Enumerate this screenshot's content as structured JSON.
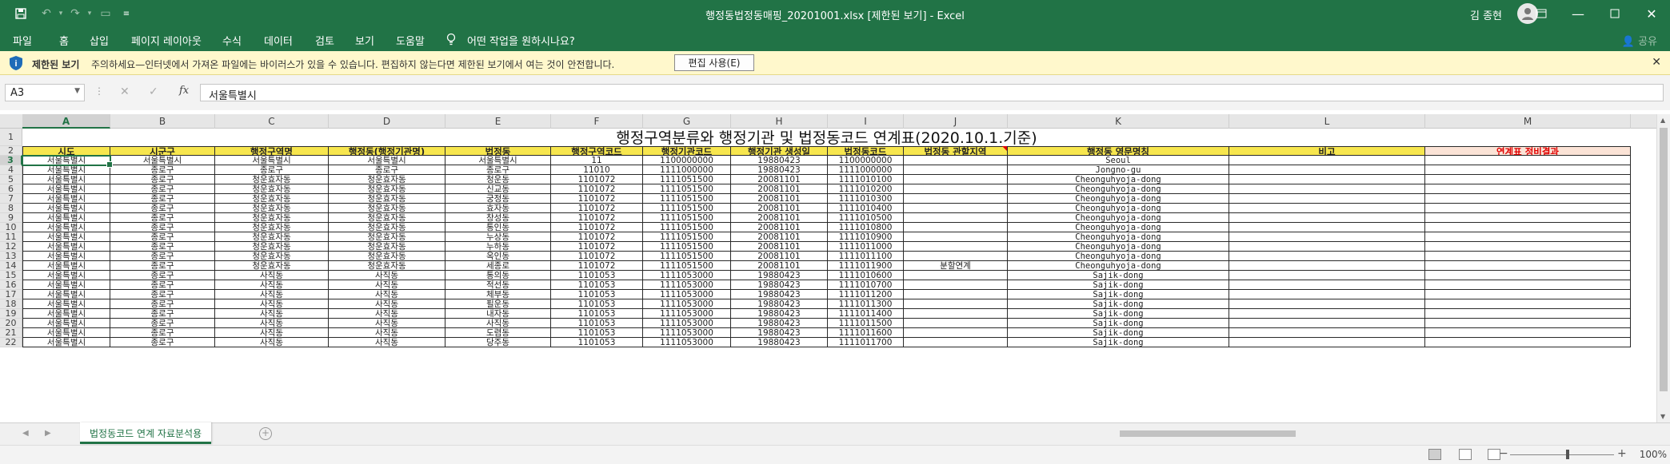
{
  "window": {
    "title": "행정동법정동매핑_20201001.xlsx  [제한된 보기]  -  Excel",
    "user": "김 종현"
  },
  "ribbon": {
    "tabs": [
      "파일",
      "홈",
      "삽입",
      "페이지 레이아웃",
      "수식",
      "데이터",
      "검토",
      "보기",
      "도움말"
    ],
    "tell_me": "어떤 작업을 원하시나요?",
    "share": "공유"
  },
  "protected_view": {
    "title": "제한된 보기",
    "message": "주의하세요—인터넷에서 가져온 파일에는 바이러스가 있을 수 있습니다. 편집하지 않는다면 제한된 보기에서 여는 것이 안전합니다.",
    "enable_button": "편집 사용(E)"
  },
  "formula_bar": {
    "name_box": "A3",
    "fx_label": "fx",
    "value": "서울특별시"
  },
  "columns": [
    "A",
    "B",
    "C",
    "D",
    "E",
    "F",
    "G",
    "H",
    "I",
    "J",
    "K",
    "L",
    "M"
  ],
  "rows": [
    "1",
    "2",
    "3",
    "4",
    "5",
    "6",
    "7",
    "8",
    "9",
    "10",
    "11",
    "12",
    "13",
    "14",
    "15",
    "16",
    "17",
    "18",
    "19",
    "20",
    "21",
    "22"
  ],
  "sheet": {
    "title": "행정구역분류와 행정기관 및 법정동코드 연계표(2020.10.1.기준)",
    "headers": [
      "시도",
      "시군구",
      "행정구역명",
      "행정동(행정기관명)",
      "법정동",
      "행정구역코드",
      "행정기관코드",
      "행정기관 생성일",
      "법정동코드",
      "법정동 관할지역",
      "행정동 영문명칭",
      "비고",
      "연계표 정비결과"
    ],
    "data": [
      [
        "서울특별시",
        "서울특별시",
        "서울특별시",
        "서울특별시",
        "서울특별시",
        "11",
        "1100000000",
        "19880423",
        "1100000000",
        "",
        "Seoul",
        "",
        ""
      ],
      [
        "서울특별시",
        "종로구",
        "종로구",
        "종로구",
        "종로구",
        "11010",
        "1111000000",
        "19880423",
        "1111000000",
        "",
        "Jongno-gu",
        "",
        ""
      ],
      [
        "서울특별시",
        "종로구",
        "청운효자동",
        "청운효자동",
        "청운동",
        "1101072",
        "1111051500",
        "20081101",
        "1111010100",
        "",
        "Cheonguhyoja-dong",
        "",
        ""
      ],
      [
        "서울특별시",
        "종로구",
        "청운효자동",
        "청운효자동",
        "신교동",
        "1101072",
        "1111051500",
        "20081101",
        "1111010200",
        "",
        "Cheonguhyoja-dong",
        "",
        ""
      ],
      [
        "서울특별시",
        "종로구",
        "청운효자동",
        "청운효자동",
        "궁정동",
        "1101072",
        "1111051500",
        "20081101",
        "1111010300",
        "",
        "Cheonguhyoja-dong",
        "",
        ""
      ],
      [
        "서울특별시",
        "종로구",
        "청운효자동",
        "청운효자동",
        "효자동",
        "1101072",
        "1111051500",
        "20081101",
        "1111010400",
        "",
        "Cheonguhyoja-dong",
        "",
        ""
      ],
      [
        "서울특별시",
        "종로구",
        "청운효자동",
        "청운효자동",
        "창성동",
        "1101072",
        "1111051500",
        "20081101",
        "1111010500",
        "",
        "Cheonguhyoja-dong",
        "",
        ""
      ],
      [
        "서울특별시",
        "종로구",
        "청운효자동",
        "청운효자동",
        "통인동",
        "1101072",
        "1111051500",
        "20081101",
        "1111010800",
        "",
        "Cheonguhyoja-dong",
        "",
        ""
      ],
      [
        "서울특별시",
        "종로구",
        "청운효자동",
        "청운효자동",
        "누상동",
        "1101072",
        "1111051500",
        "20081101",
        "1111010900",
        "",
        "Cheonguhyoja-dong",
        "",
        ""
      ],
      [
        "서울특별시",
        "종로구",
        "청운효자동",
        "청운효자동",
        "누하동",
        "1101072",
        "1111051500",
        "20081101",
        "1111011000",
        "",
        "Cheonguhyoja-dong",
        "",
        ""
      ],
      [
        "서울특별시",
        "종로구",
        "청운효자동",
        "청운효자동",
        "옥인동",
        "1101072",
        "1111051500",
        "20081101",
        "1111011100",
        "",
        "Cheonguhyoja-dong",
        "",
        ""
      ],
      [
        "서울특별시",
        "종로구",
        "청운효자동",
        "청운효자동",
        "세종로",
        "1101072",
        "1111051500",
        "20081101",
        "1111011900",
        "분할연계",
        "Cheonguhyoja-dong",
        "",
        ""
      ],
      [
        "서울특별시",
        "종로구",
        "사직동",
        "사직동",
        "통의동",
        "1101053",
        "1111053000",
        "19880423",
        "1111010600",
        "",
        "Sajik-dong",
        "",
        ""
      ],
      [
        "서울특별시",
        "종로구",
        "사직동",
        "사직동",
        "적선동",
        "1101053",
        "1111053000",
        "19880423",
        "1111010700",
        "",
        "Sajik-dong",
        "",
        ""
      ],
      [
        "서울특별시",
        "종로구",
        "사직동",
        "사직동",
        "체부동",
        "1101053",
        "1111053000",
        "19880423",
        "1111011200",
        "",
        "Sajik-dong",
        "",
        ""
      ],
      [
        "서울특별시",
        "종로구",
        "사직동",
        "사직동",
        "필운동",
        "1101053",
        "1111053000",
        "19880423",
        "1111011300",
        "",
        "Sajik-dong",
        "",
        ""
      ],
      [
        "서울특별시",
        "종로구",
        "사직동",
        "사직동",
        "내자동",
        "1101053",
        "1111053000",
        "19880423",
        "1111011400",
        "",
        "Sajik-dong",
        "",
        ""
      ],
      [
        "서울특별시",
        "종로구",
        "사직동",
        "사직동",
        "사직동",
        "1101053",
        "1111053000",
        "19880423",
        "1111011500",
        "",
        "Sajik-dong",
        "",
        ""
      ],
      [
        "서울특별시",
        "종로구",
        "사직동",
        "사직동",
        "도렴동",
        "1101053",
        "1111053000",
        "19880423",
        "1111011600",
        "",
        "Sajik-dong",
        "",
        ""
      ],
      [
        "서울특별시",
        "종로구",
        "사직동",
        "사직동",
        "당주동",
        "1101053",
        "1111053000",
        "19880423",
        "1111011700",
        "",
        "Sajik-dong",
        "",
        ""
      ]
    ]
  },
  "sheet_tabs": [
    "법정동코드 연계 자료분석용"
  ],
  "status": {
    "zoom": "100%"
  },
  "colors": {
    "excel_green": "#217346",
    "header_yellow": "#f7e64e",
    "warning_bar": "#fff8cc",
    "alert_red": "#e00000"
  }
}
